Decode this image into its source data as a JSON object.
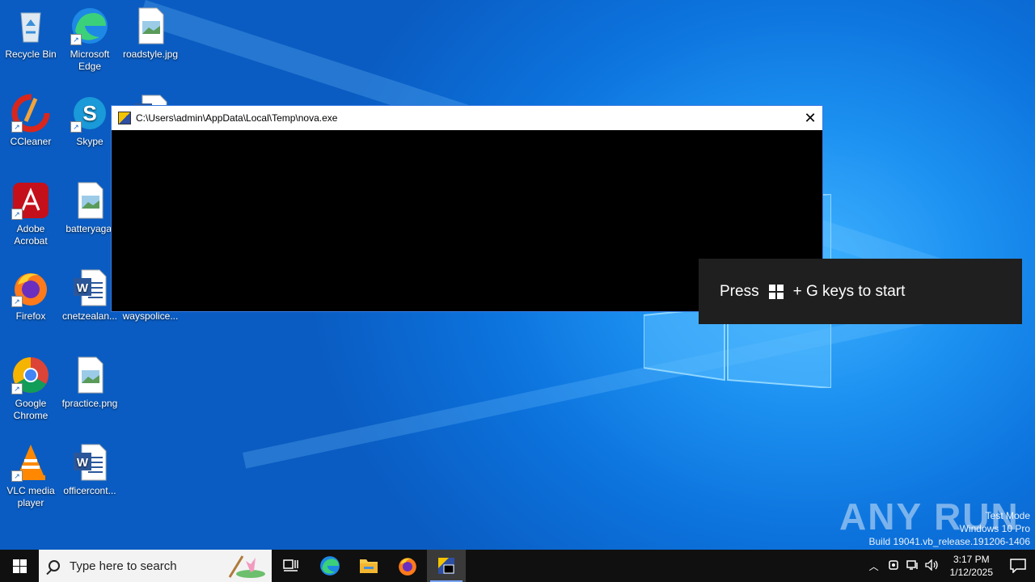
{
  "desktop_icons": [
    {
      "label": "Recycle Bin",
      "icon": "recycle-bin-icon"
    },
    {
      "label": "Microsoft Edge",
      "icon": "edge-icon"
    },
    {
      "label": "roadstyle.jpg",
      "icon": "image-file-icon"
    },
    {
      "label": "CCleaner",
      "icon": "ccleaner-icon"
    },
    {
      "label": "Skype",
      "icon": "skype-icon"
    },
    {
      "label": "Adobe Acrobat",
      "icon": "acrobat-icon"
    },
    {
      "label": "batteryagai",
      "icon": "image-file-icon"
    },
    {
      "label": "Firefox",
      "icon": "firefox-icon"
    },
    {
      "label": "cnetzealan...",
      "icon": "word-doc-icon"
    },
    {
      "label": "wayspolice...",
      "icon": "word-doc-icon"
    },
    {
      "label": "Google Chrome",
      "icon": "chrome-icon"
    },
    {
      "label": "fpractice.png",
      "icon": "image-file-icon"
    },
    {
      "label": "VLC media player",
      "icon": "vlc-icon"
    },
    {
      "label": "officercont...",
      "icon": "word-doc-icon"
    }
  ],
  "console_window": {
    "title": "C:\\Users\\admin\\AppData\\Local\\Temp\\nova.exe",
    "close_symbol": "✕"
  },
  "game_bar_toast": {
    "prefix": "Press",
    "suffix": "+ G keys to start"
  },
  "watermark": {
    "brand": "ANY RUN",
    "line1": "Test Mode",
    "line2": "Windows 10 Pro",
    "line3": "Build 19041.vb_release.191206-1406"
  },
  "taskbar": {
    "search_placeholder": "Type here to search",
    "clock_time": "3:17 PM",
    "clock_date": "1/12/2025"
  },
  "colors": {
    "desktop_bg": "#0c72dc",
    "taskbar_bg": "#101010",
    "toast_bg": "#1f1f1f"
  }
}
